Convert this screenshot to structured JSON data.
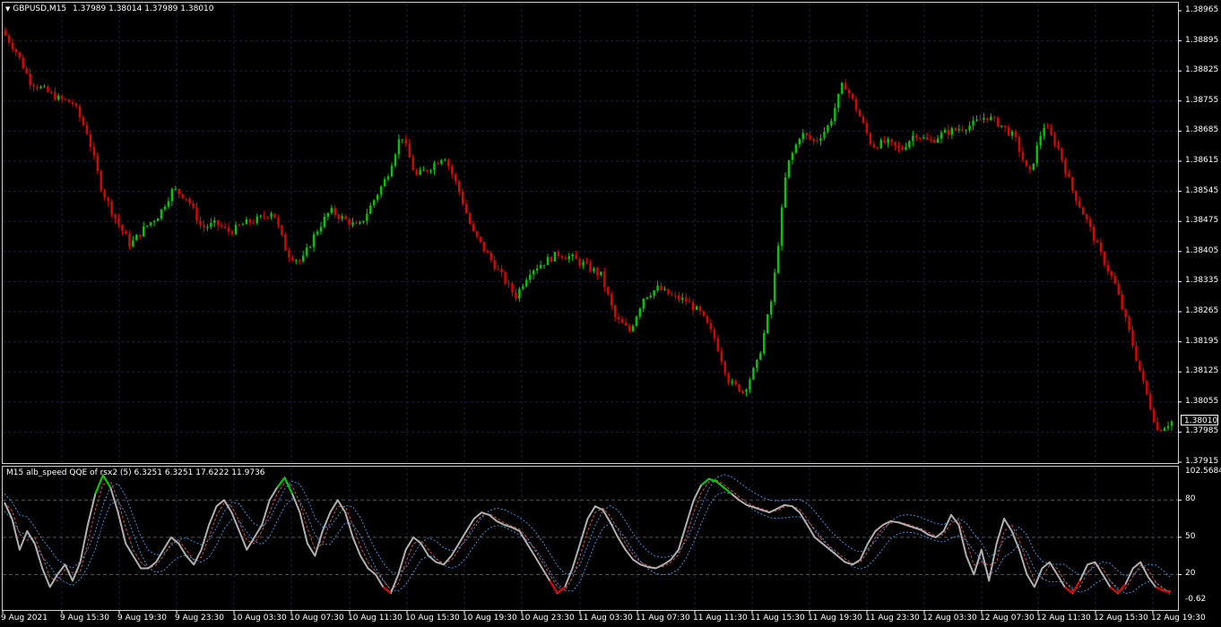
{
  "header": {
    "symbol": "GBPUSD,M15",
    "ohlc": "1.37989 1.38014 1.37989 1.38010"
  },
  "main_axis": {
    "labels": [
      "1.38965",
      "1.38895",
      "1.38825",
      "1.38755",
      "1.38685",
      "1.38615",
      "1.38545",
      "1.38475",
      "1.38405",
      "1.38335",
      "1.38265",
      "1.38195",
      "1.38125",
      "1.38055",
      "1.37985",
      "1.37915"
    ],
    "current_price": "1.38010"
  },
  "indicator": {
    "title": "M15 alb_speed QQE of rsx2 (5) 6.3251 6.3251 17.6222 11.9736",
    "axis_labels": [
      "102.5684",
      "80",
      "50",
      "20",
      "-0.62"
    ]
  },
  "time_axis": {
    "labels": [
      "9 Aug 2021",
      "9 Aug 15:30",
      "9 Aug 19:30",
      "9 Aug 23:30",
      "10 Aug 03:30",
      "10 Aug 07:30",
      "10 Aug 11:30",
      "10 Aug 15:30",
      "10 Aug 19:30",
      "10 Aug 23:30",
      "11 Aug 03:30",
      "11 Aug 07:30",
      "11 Aug 11:30",
      "11 Aug 15:30",
      "11 Aug 19:30",
      "11 Aug 23:30",
      "12 Aug 03:30",
      "12 Aug 07:30",
      "12 Aug 11:30",
      "12 Aug 15:30",
      "12 Aug 19:30"
    ]
  },
  "colors": {
    "background": "#000000",
    "bull": "#00c800",
    "bear": "#e00000",
    "grid": "#1c1c3c",
    "fg": "#ffffff",
    "qqe_line": "#b0b0b0",
    "qqe_fast": "#c85050",
    "qqe_band": "#3a8fd8",
    "level": "#555555"
  },
  "chart_data": [
    {
      "type": "candlestick",
      "title": "GBPUSD,M15",
      "ylim": [
        1.37915,
        1.38965
      ],
      "x_categories": [
        "9 Aug 2021",
        "9 Aug 15:30",
        "9 Aug 19:30",
        "9 Aug 23:30",
        "10 Aug 03:30",
        "10 Aug 07:30",
        "10 Aug 11:30",
        "10 Aug 15:30",
        "10 Aug 19:30",
        "10 Aug 23:30",
        "11 Aug 03:30",
        "11 Aug 07:30",
        "11 Aug 11:30",
        "11 Aug 15:30",
        "11 Aug 19:30",
        "11 Aug 23:30",
        "12 Aug 03:30",
        "12 Aug 07:30",
        "12 Aug 11:30",
        "12 Aug 15:30",
        "12 Aug 19:30"
      ],
      "close_path": [
        1.3892,
        1.3887,
        1.388,
        1.3878,
        1.3876,
        1.3875,
        1.3868,
        1.3855,
        1.3848,
        1.3842,
        1.3846,
        1.3849,
        1.3855,
        1.3853,
        1.3846,
        1.3847,
        1.3845,
        1.3847,
        1.3848,
        1.385,
        1.384,
        1.3838,
        1.3845,
        1.385,
        1.3848,
        1.3846,
        1.3852,
        1.3858,
        1.3868,
        1.3858,
        1.386,
        1.3863,
        1.3855,
        1.3845,
        1.384,
        1.3835,
        1.383,
        1.3836,
        1.3838,
        1.384,
        1.3839,
        1.3837,
        1.3835,
        1.3825,
        1.3822,
        1.383,
        1.3832,
        1.383,
        1.3829,
        1.3826,
        1.382,
        1.381,
        1.3808,
        1.3815,
        1.383,
        1.386,
        1.3868,
        1.3866,
        1.387,
        1.388,
        1.3873,
        1.3865,
        1.3866,
        1.3864,
        1.3868,
        1.3866,
        1.3868,
        1.3869,
        1.387,
        1.3872,
        1.387,
        1.3867,
        1.3858,
        1.387,
        1.3865,
        1.3855,
        1.3848,
        1.384,
        1.3833,
        1.3822,
        1.381,
        1.3799,
        1.3801
      ],
      "current_price": 1.3801
    },
    {
      "type": "line",
      "title": "M15 alb_speed QQE of rsx2 (5) 6.3251 6.3251 17.6222 11.9736",
      "ylim": [
        -0.62,
        102.5684
      ],
      "levels": [
        20,
        50,
        80
      ],
      "series": [
        {
          "values": [
            78,
            65,
            40,
            55,
            45,
            25,
            10,
            20,
            28,
            15,
            30,
            60,
            85,
            100,
            90,
            70,
            45,
            35,
            25,
            25,
            30,
            40,
            50,
            45,
            35,
            28,
            40,
            60,
            75,
            80,
            70,
            55,
            40,
            50,
            60,
            80,
            90,
            98,
            85,
            70,
            45,
            35,
            55,
            70,
            80,
            70,
            50,
            35,
            25,
            20,
            10,
            5,
            20,
            40,
            50,
            45,
            35,
            30,
            28,
            35,
            45,
            55,
            65,
            70,
            68,
            63,
            60,
            58,
            55,
            45,
            35,
            25,
            15,
            5,
            10,
            25,
            45,
            65,
            75,
            72,
            62,
            50,
            40,
            32,
            28,
            26,
            25,
            28,
            32,
            40,
            60,
            80,
            92,
            97,
            95,
            90,
            85,
            80,
            76,
            74,
            72,
            70,
            73,
            76,
            75,
            70,
            60,
            50,
            45,
            40,
            35,
            30,
            28,
            32,
            45,
            55,
            60,
            63,
            62,
            60,
            58,
            56,
            52,
            50,
            55,
            68,
            60,
            35,
            20,
            40,
            15,
            45,
            65,
            55,
            40,
            20,
            10,
            25,
            30,
            20,
            10,
            5,
            15,
            28,
            30,
            20,
            10,
            5,
            12,
            25,
            30,
            18,
            10,
            7,
            6
          ]
        }
      ]
    }
  ]
}
